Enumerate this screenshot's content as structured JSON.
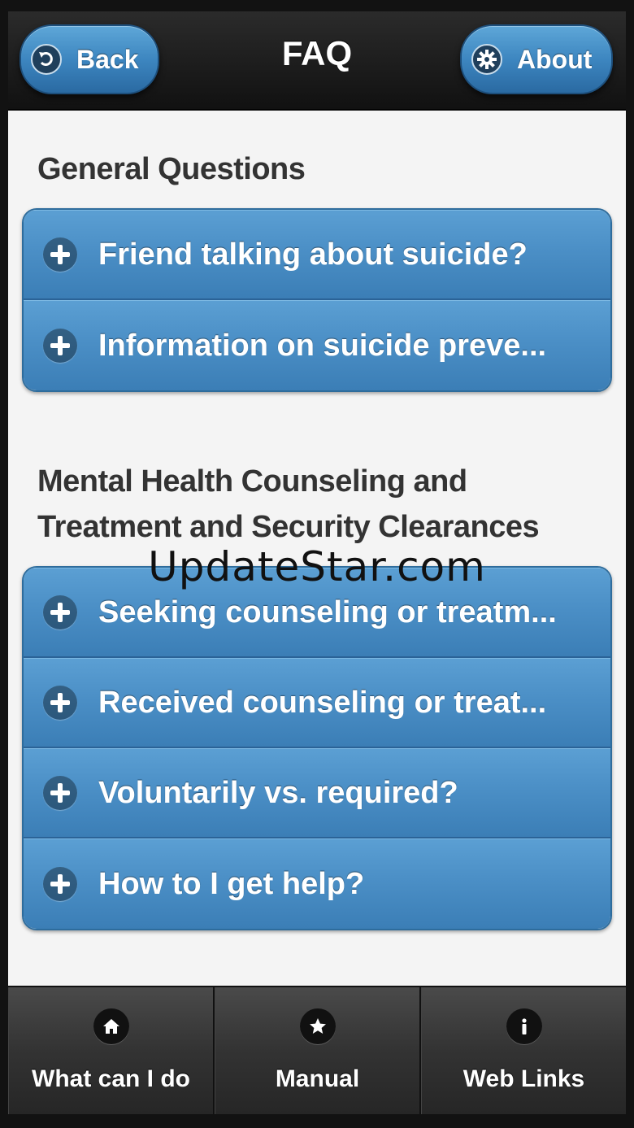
{
  "header": {
    "back_label": "Back",
    "title": "FAQ",
    "about_label": "About"
  },
  "sections": [
    {
      "title_lines": [
        "General Questions"
      ],
      "items": [
        "Friend talking about suicide?",
        "Information on suicide preve..."
      ]
    },
    {
      "title_lines": [
        "Mental Health Counseling and",
        "Treatment and Security Clearances"
      ],
      "items": [
        "Seeking counseling or treatm...",
        "Received counseling or treat...",
        "Voluntarily vs. required?",
        "How to I get help?"
      ]
    }
  ],
  "watermark": "UpdateStar.com",
  "tabs": [
    {
      "label": "What can I do",
      "icon": "home-icon"
    },
    {
      "label": "Manual",
      "icon": "star-icon"
    },
    {
      "label": "Web Links",
      "icon": "info-icon"
    }
  ],
  "colors": {
    "accent": "#4b8fc6",
    "header_bg": "#1c1c1c",
    "content_bg": "#f4f4f4"
  }
}
